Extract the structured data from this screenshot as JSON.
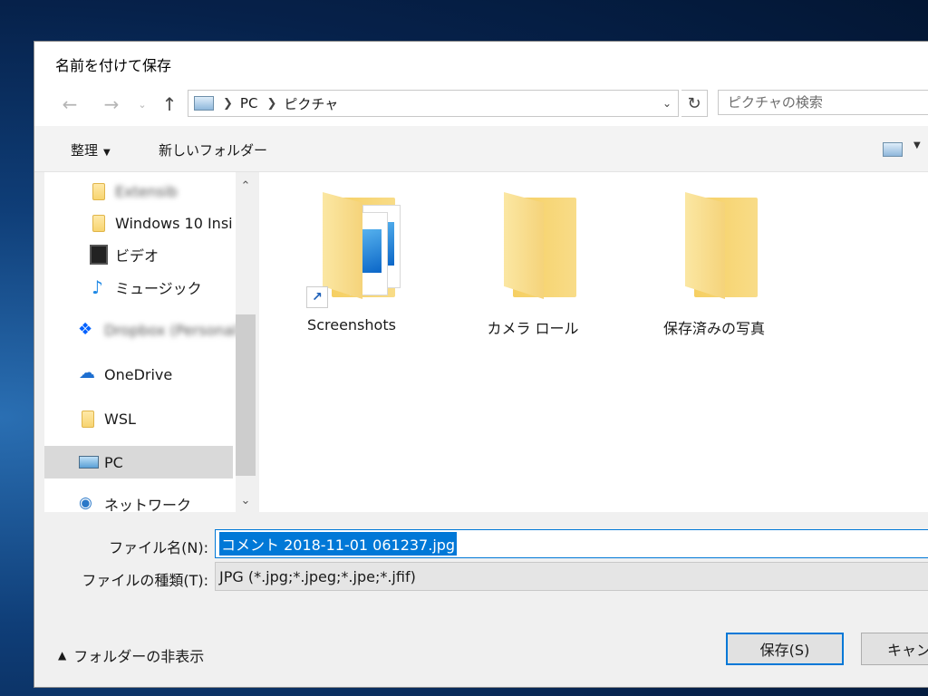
{
  "window": {
    "title": "名前を付けて保存"
  },
  "nav": {
    "back_icon": "back-arrow-icon",
    "forward_icon": "forward-arrow-icon",
    "recent_icon": "chevron-down-icon",
    "up_icon": "up-arrow-icon",
    "address": {
      "crumbs": [
        "PC",
        "ピクチャ"
      ]
    },
    "search_placeholder": "ピクチャの検索"
  },
  "toolbar": {
    "organize": "整理",
    "new_folder": "新しいフォルダー"
  },
  "sidebar": {
    "items": [
      {
        "label": "Extensib",
        "icon": "folder-icon",
        "blurred": true
      },
      {
        "label": "Windows 10 Insi",
        "icon": "folder-icon"
      },
      {
        "label": "ビデオ",
        "icon": "video-icon"
      },
      {
        "label": "ミュージック",
        "icon": "music-icon"
      },
      {
        "label": "Dropbox (Personal)",
        "icon": "dropbox-icon",
        "blurred": true
      },
      {
        "label": "OneDrive",
        "icon": "onedrive-icon"
      },
      {
        "label": "WSL",
        "icon": "folder-icon"
      },
      {
        "label": "PC",
        "icon": "pc-icon",
        "selected": true
      },
      {
        "label": "ネットワーク",
        "icon": "network-icon"
      }
    ]
  },
  "content": {
    "items": [
      {
        "label": "Screenshots",
        "type": "folder-with-photos",
        "shortcut": true
      },
      {
        "label": "カメラ ロール",
        "type": "folder"
      },
      {
        "label": "保存済みの写真",
        "type": "folder"
      }
    ]
  },
  "form": {
    "filename_label": "ファイル名(N):",
    "filename_value": "コメント 2018-11-01 061237.jpg",
    "filetype_label": "ファイルの種類(T):",
    "filetype_value": "JPG (*.jpg;*.jpeg;*.jpe;*.jfif)"
  },
  "footer": {
    "hide_folders": "フォルダーの非表示",
    "save": "保存(S)",
    "cancel": "キャンセル"
  },
  "colors": {
    "accent": "#0078d7",
    "folder": "#f7d470",
    "selected_nav": "#d9d9d9"
  }
}
